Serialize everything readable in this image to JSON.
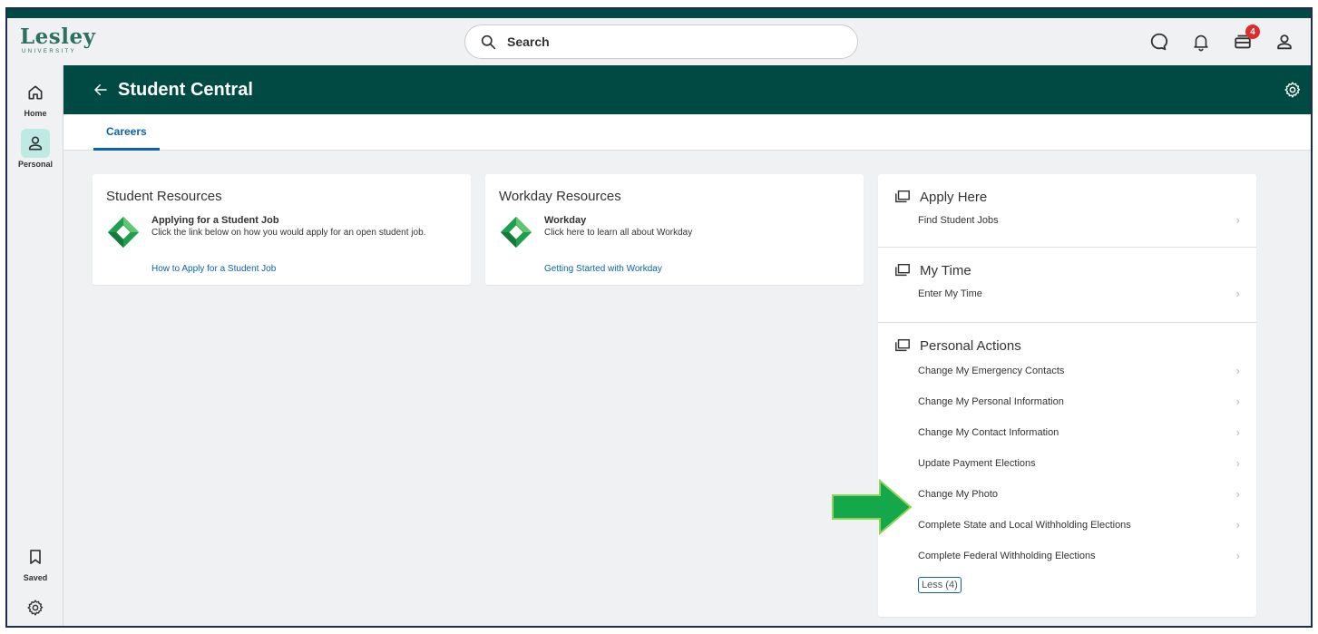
{
  "header": {
    "logo_word": "Lesley",
    "logo_sub": "UNIVERSITY",
    "search_placeholder": "Search",
    "inbox_badge": "4",
    "icons": [
      "chat-icon",
      "bell-icon",
      "inbox-icon",
      "profile-icon"
    ]
  },
  "sidebar": {
    "items": [
      {
        "label": "Home",
        "icon": "home-icon"
      },
      {
        "label": "Personal",
        "icon": "person-icon"
      },
      {
        "label": "Saved",
        "icon": "bookmark-icon"
      },
      {
        "label": "",
        "icon": "gear-icon"
      }
    ]
  },
  "banner": {
    "title": "Student Central"
  },
  "tabs": [
    {
      "label": "Careers",
      "active": true
    }
  ],
  "student_resources": {
    "heading": "Student Resources",
    "item_title": "Applying for a Student Job",
    "item_desc": "Click the link below on how you would apply for an open student job.",
    "link": "How to Apply for a Student Job"
  },
  "workday_resources": {
    "heading": "Workday Resources",
    "item_title": "Workday",
    "item_desc": "Click here to learn all about Workday",
    "link": "Getting Started with Workday"
  },
  "worklets": {
    "apply_here": {
      "heading": "Apply Here",
      "items": [
        "Find Student Jobs"
      ]
    },
    "my_time": {
      "heading": "My Time",
      "items": [
        "Enter My Time"
      ]
    },
    "personal_actions": {
      "heading": "Personal Actions",
      "items": [
        "Change My Emergency Contacts",
        "Change My Personal Information",
        "Change My Contact Information",
        "Update Payment Elections",
        "Change My Photo",
        "Complete State and Local Withholding Elections",
        "Complete Federal Withholding Elections"
      ],
      "less_label": "Less (4)"
    }
  },
  "colors": {
    "brand_dark": "#004a44",
    "accent_blue": "#0b63b0",
    "badge_red": "#de2b2b",
    "arrow_green": "#14a84a"
  }
}
